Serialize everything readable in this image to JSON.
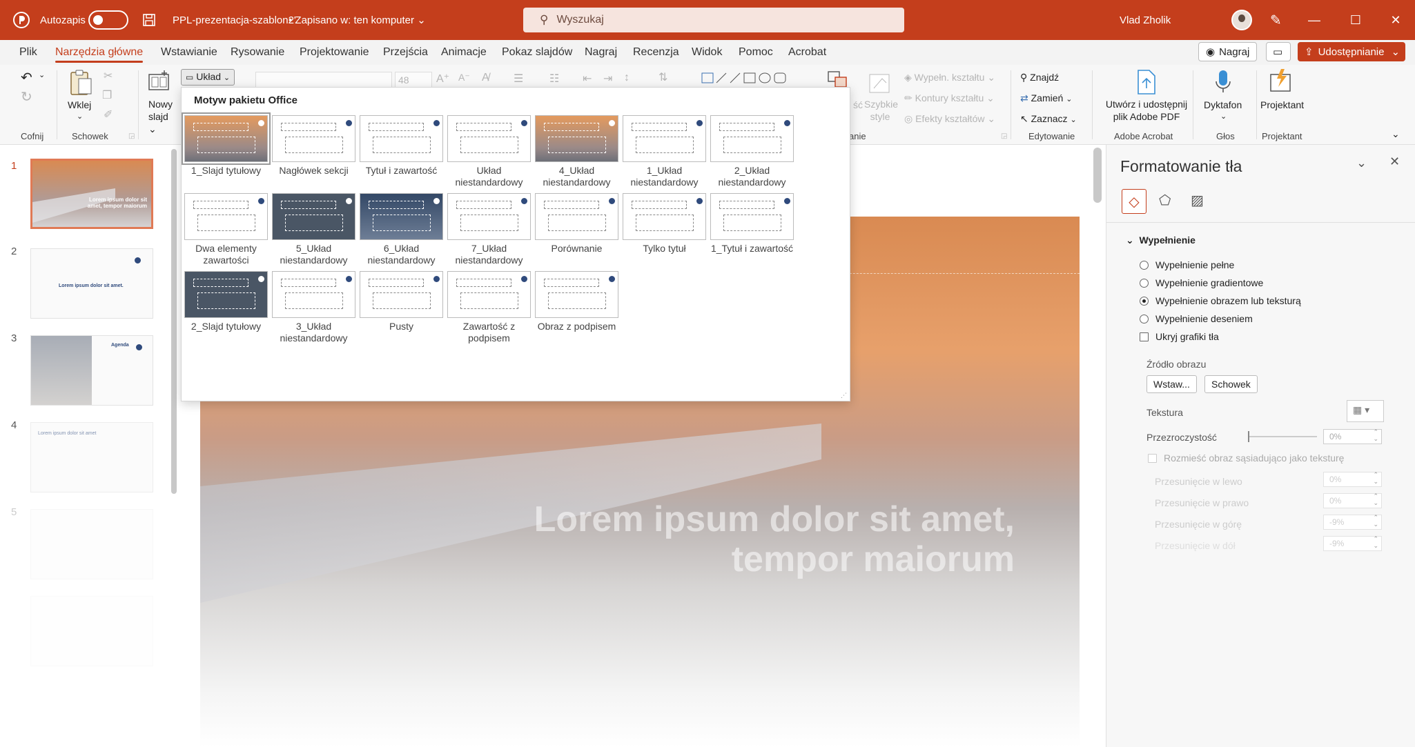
{
  "titlebar": {
    "autosave_label": "Autozapis",
    "doc_title": "PPL-prezentacja-szablon2'",
    "save_status": "• Zapisano w: ten komputer",
    "search_placeholder": "Wyszukaj",
    "user_name": "Vlad Zholik"
  },
  "tabs": [
    "Plik",
    "Narzędzia główne",
    "Wstawianie",
    "Rysowanie",
    "Projektowanie",
    "Przejścia",
    "Animacje",
    "Pokaz slajdów",
    "Nagraj",
    "Recenzja",
    "Widok",
    "Pomoc",
    "Acrobat"
  ],
  "active_tab": "Narzędzia główne",
  "tab_actions": {
    "record": "Nagraj",
    "share": "Udostępnianie"
  },
  "ribbon": {
    "undo_group": "Cofnij",
    "paste": "Wklej",
    "clipboard_group": "Schowek",
    "new_slide": "Nowy slajd",
    "layout": "Układ",
    "font_size": "48",
    "quick_styles": "Szybkie style",
    "shape_fill": "Wypełn. kształtu",
    "shape_outline": "Kontury kształtu",
    "shape_effects": "Efekty kształtów",
    "drawing_group_tail": "anie",
    "find": "Znajdź",
    "replace": "Zamień",
    "select": "Zaznacz",
    "editing_group": "Edytowanie",
    "acrobat_btn": "Utwórz i udostępnij plik Adobe PDF",
    "acrobat_group": "Adobe Acrobat",
    "dictate": "Dyktafon",
    "voice_group": "Głos",
    "designer": "Projektant",
    "designer_group": "Projektant"
  },
  "gallery": {
    "header": "Motyw pakietu Office",
    "layouts": [
      {
        "name": "1_Slajd tytułowy",
        "style": "sky",
        "selected": true
      },
      {
        "name": "Nagłówek sekcji",
        "style": "white"
      },
      {
        "name": "Tytuł i zawartość",
        "style": "white"
      },
      {
        "name": "Układ niestandardowy",
        "style": "white"
      },
      {
        "name": "4_Układ niestandardowy",
        "style": "sky"
      },
      {
        "name": "1_Układ niestandardowy",
        "style": "white"
      },
      {
        "name": "2_Układ niestandardowy",
        "style": "white"
      },
      {
        "name": "Dwa elementy zawartości",
        "style": "white"
      },
      {
        "name": "5_Układ niestandardowy",
        "style": "dark"
      },
      {
        "name": "6_Układ niestandardowy",
        "style": "navy"
      },
      {
        "name": "7_Układ niestandardowy",
        "style": "white"
      },
      {
        "name": "Porównanie",
        "style": "white"
      },
      {
        "name": "Tylko tytuł",
        "style": "white"
      },
      {
        "name": "1_Tytuł i zawartość",
        "style": "white"
      },
      {
        "name": "2_Slajd tytułowy",
        "style": "dark"
      },
      {
        "name": "3_Układ niestandardowy",
        "style": "white"
      },
      {
        "name": "Pusty",
        "style": "white"
      },
      {
        "name": "Zawartość z podpisem",
        "style": "white"
      },
      {
        "name": "Obraz z podpisem",
        "style": "white"
      }
    ]
  },
  "thumbnails": [
    {
      "num": "1",
      "text": "Lorem ipsum dolor sit amet, tempor maiorum"
    },
    {
      "num": "2",
      "text": "Lorem ipsum dolor sit amet."
    },
    {
      "num": "3",
      "text": "Agenda"
    },
    {
      "num": "4",
      "text": "Lorem ipsum dolor sit amet"
    },
    {
      "num": "5",
      "text": ""
    }
  ],
  "slide": {
    "title": "Lorem ipsum dolor sit amet, tempor maiorum"
  },
  "format_pane": {
    "title": "Formatowanie tła",
    "section": "Wypełnienie",
    "fill_options": [
      {
        "label": "Wypełnienie pełne",
        "checked": false
      },
      {
        "label": "Wypełnienie gradientowe",
        "checked": false
      },
      {
        "label": "Wypełnienie obrazem lub teksturą",
        "checked": true
      },
      {
        "label": "Wypełnienie deseniem",
        "checked": false
      }
    ],
    "hide_graphics": "Ukryj grafiki tła",
    "image_source": "Źródło obrazu",
    "insert_btn": "Wstaw...",
    "clipboard_btn": "Schowek",
    "texture": "Tekstura",
    "transparency": "Przezroczystość",
    "transparency_value": "0%",
    "tile_option": "Rozmieść obraz sąsiadująco jako teksturę",
    "offsets": [
      {
        "label": "Przesunięcie w lewo",
        "value": "0%"
      },
      {
        "label": "Przesunięcie w prawo",
        "value": "0%"
      },
      {
        "label": "Przesunięcie w górę",
        "value": "-9%"
      },
      {
        "label": "Przesunięcie w dół",
        "value": "-9%"
      }
    ]
  },
  "colors": {
    "accent": "#c43e1c",
    "ribbon": "#f7f7f7"
  }
}
